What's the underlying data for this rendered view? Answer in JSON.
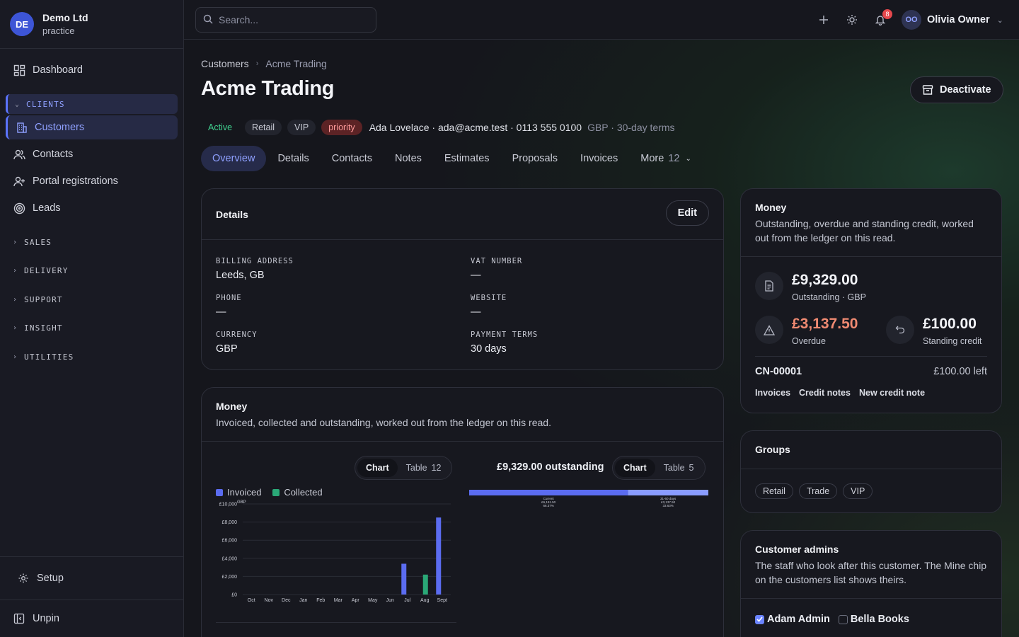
{
  "org": {
    "initials": "DE",
    "name": "Demo Ltd",
    "subtitle": "practice"
  },
  "sidebar": {
    "dashboard": "Dashboard",
    "clients_section": "CLIENTS",
    "items": [
      {
        "label": "Customers",
        "icon": "building-icon"
      },
      {
        "label": "Contacts",
        "icon": "users-icon"
      },
      {
        "label": "Portal registrations",
        "icon": "user-plus-icon"
      },
      {
        "label": "Leads",
        "icon": "target-icon"
      }
    ],
    "sections": [
      "SALES",
      "DELIVERY",
      "SUPPORT",
      "INSIGHT",
      "UTILITIES"
    ],
    "setup": "Setup",
    "unpin": "Unpin"
  },
  "topbar": {
    "search_placeholder": "Search...",
    "notifications_count": "8",
    "user_initials": "OO",
    "user_name": "Olivia Owner"
  },
  "breadcrumb": {
    "parent": "Customers",
    "current": "Acme Trading"
  },
  "page": {
    "title": "Acme Trading",
    "deactivate_label": "Deactivate",
    "tags": [
      "Active",
      "Retail",
      "VIP",
      "priority"
    ],
    "contact_line": "Ada Lovelace · ada@acme.test · 0113 555 0100",
    "currency_terms": "GBP · 30-day terms"
  },
  "tabs": [
    {
      "label": "Overview"
    },
    {
      "label": "Details"
    },
    {
      "label": "Contacts"
    },
    {
      "label": "Notes"
    },
    {
      "label": "Estimates"
    },
    {
      "label": "Proposals"
    },
    {
      "label": "Invoices"
    },
    {
      "label": "More",
      "count": "12"
    }
  ],
  "details_card": {
    "title": "Details",
    "edit_label": "Edit",
    "fields": [
      {
        "label": "BILLING ADDRESS",
        "value": "Leeds, GB"
      },
      {
        "label": "VAT NUMBER",
        "value": "—"
      },
      {
        "label": "PHONE",
        "value": "—"
      },
      {
        "label": "WEBSITE",
        "value": "—"
      },
      {
        "label": "CURRENCY",
        "value": "GBP"
      },
      {
        "label": "PAYMENT TERMS",
        "value": "30 days"
      }
    ]
  },
  "money_main": {
    "title": "Money",
    "subtitle": "Invoiced, collected and outstanding, worked out from the ledger on this read.",
    "toggle1": {
      "chart": "Chart",
      "table": "Table",
      "count": "12"
    },
    "toggle2": {
      "chart": "Chart",
      "table": "Table",
      "count": "5"
    },
    "outstanding_label": "£9,329.00 outstanding",
    "aging": {
      "segments": [
        {
          "label": "Current",
          "amount": "£6,191.50",
          "pct": "66.37%",
          "value": 6191.5,
          "color": "#5b6cf0"
        },
        {
          "label": "31-60 days",
          "amount": "£3,137.50",
          "pct": "33.63%",
          "value": 3137.5,
          "color": "#8a9cff"
        }
      ]
    }
  },
  "chart_data": {
    "type": "bar",
    "unit": "GBP",
    "categories": [
      "Oct",
      "Nov",
      "Dec",
      "Jan",
      "Feb",
      "Mar",
      "Apr",
      "May",
      "Jun",
      "Jul",
      "Aug",
      "Sept"
    ],
    "series": [
      {
        "name": "Invoiced",
        "color": "#5b6cf0",
        "values": [
          0,
          0,
          0,
          0,
          0,
          0,
          0,
          0,
          0,
          3400,
          0,
          8500
        ]
      },
      {
        "name": "Collected",
        "color": "#2aa877",
        "values": [
          0,
          0,
          0,
          0,
          0,
          0,
          0,
          0,
          0,
          0,
          2200,
          0
        ]
      }
    ],
    "yticks": [
      "£0",
      "£2,000",
      "£4,000",
      "£6,000",
      "£8,000",
      "£10,000"
    ],
    "ylim": [
      0,
      10000
    ]
  },
  "money_side": {
    "title": "Money",
    "subtitle": "Outstanding, overdue and standing credit, worked out from the ledger on this read.",
    "outstanding": {
      "amount": "£9,329.00",
      "label": "Outstanding · GBP"
    },
    "overdue": {
      "amount": "£3,137.50",
      "label": "Overdue"
    },
    "credit": {
      "amount": "£100.00",
      "label": "Standing credit"
    },
    "credit_note": {
      "id": "CN-00001",
      "left": "£100.00 left"
    },
    "links": [
      "Invoices",
      "Credit notes",
      "New credit note"
    ]
  },
  "groups": {
    "title": "Groups",
    "items": [
      "Retail",
      "Trade",
      "VIP"
    ]
  },
  "admins": {
    "title": "Customer admins",
    "subtitle": "The staff who look after this customer. The Mine chip on the customers list shows theirs.",
    "people": [
      {
        "name": "Adam Admin",
        "checked": true
      },
      {
        "name": "Bella Books",
        "checked": false
      }
    ]
  },
  "colors": {
    "accent": "#8fa0ff",
    "invoiced": "#5b6cf0",
    "collected": "#2aa877",
    "overdue": "#f08a72",
    "active": "#3fcf8e"
  }
}
